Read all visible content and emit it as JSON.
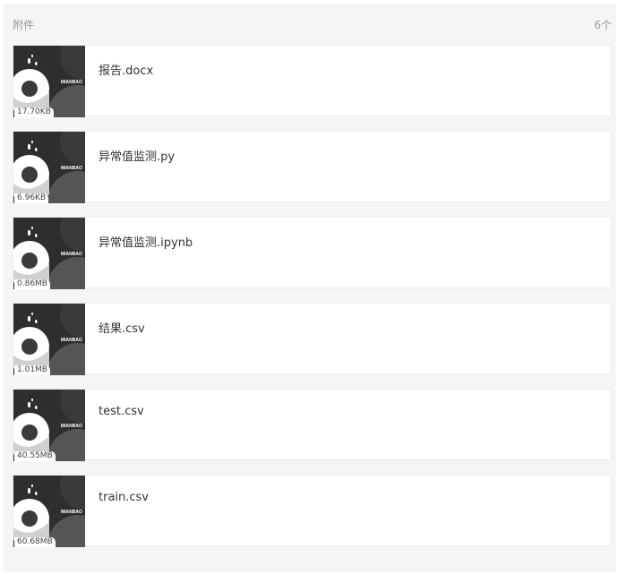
{
  "attachments": {
    "title": "附件",
    "count": "6个",
    "thumb_brand": "MIANBAO",
    "files": [
      {
        "name": "报告.docx",
        "size": "17.70KB"
      },
      {
        "name": "异常值监测.py",
        "size": "6.96KB"
      },
      {
        "name": "异常值监测.ipynb",
        "size": "0.86MB"
      },
      {
        "name": "结果.csv",
        "size": "1.01MB"
      },
      {
        "name": "test.csv",
        "size": "40.55MB"
      },
      {
        "name": "train.csv",
        "size": "60.68MB"
      }
    ]
  },
  "colors": {
    "panel_bg": "#f5f5f5",
    "card_bg": "#ffffff",
    "thumb_bg": "#2e2e2e",
    "text_primary": "#333333",
    "text_muted": "#999999"
  }
}
